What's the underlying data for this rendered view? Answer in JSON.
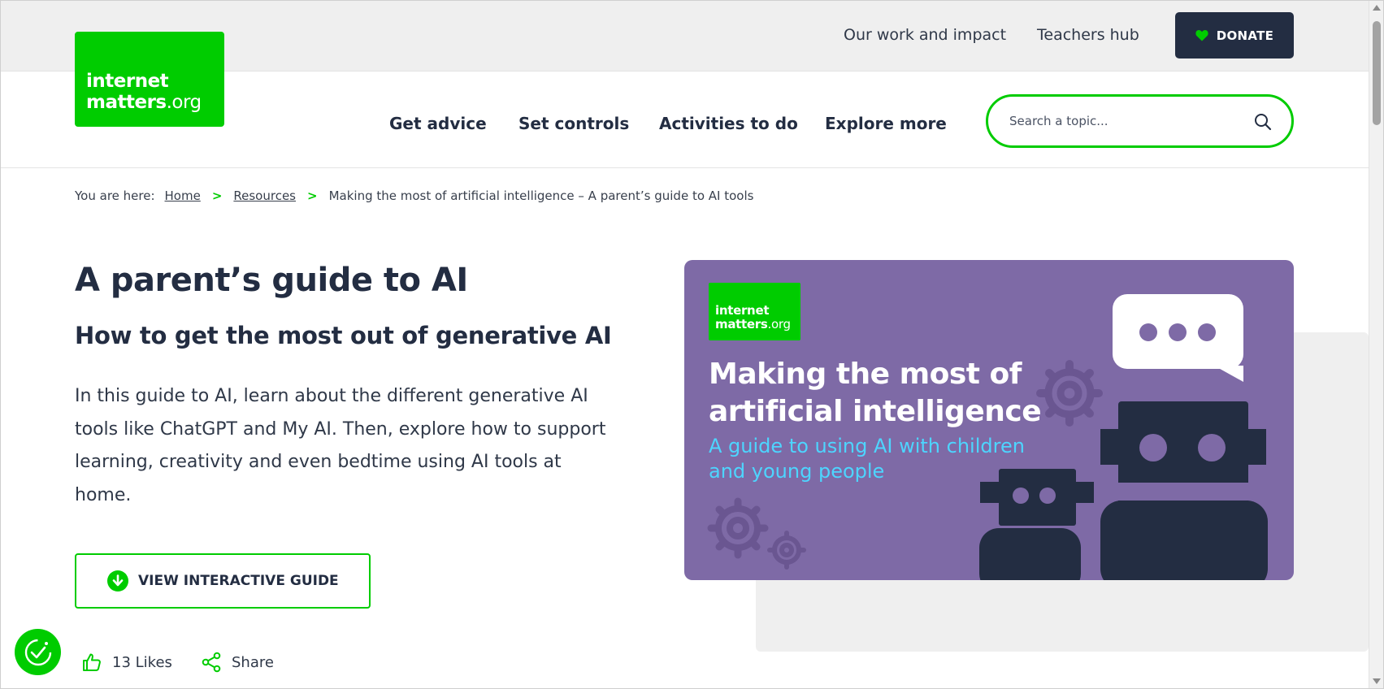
{
  "header": {
    "logo": {
      "line1": "internet",
      "line2": "matters",
      "line2_suffix": ".org"
    },
    "top_links": [
      "Our work and impact",
      "Teachers hub"
    ],
    "donate_label": "DONATE",
    "nav": [
      "Get advice",
      "Set controls",
      "Activities to do",
      "Explore more"
    ],
    "search": {
      "placeholder": "Search a topic...",
      "value": ""
    }
  },
  "breadcrumb": {
    "lead": "You are here:",
    "items": [
      "Home",
      "Resources",
      "Making the most of artificial intelligence – A parent’s guide to AI tools"
    ]
  },
  "article": {
    "title": "A parent’s guide to AI",
    "subtitle": "How to get the most out of generative AI",
    "description": "In this guide to AI, learn about the different generative AI tools like ChatGPT and My AI. Then, explore how to support learning, creativity and even bedtime using AI tools at home.",
    "guide_button": "VIEW INTERACTIVE GUIDE",
    "likes": "13 Likes",
    "share": "Share"
  },
  "hero": {
    "logo": {
      "line1": "internet",
      "line2": "matters",
      "line2_suffix": ".org"
    },
    "title": "Making the most of artificial intelligence",
    "subtitle": "A guide to using AI with children and young people"
  },
  "colors": {
    "brand_green": "#00cc00",
    "navy": "#232d42",
    "hero_purple": "#7e6aa6",
    "hero_subtitle_blue": "#4dd5ff",
    "topbar_grey": "#efefef"
  },
  "icons": [
    "heart-icon",
    "search-icon",
    "chevron-right-icon",
    "download-arrow-icon",
    "thumbs-up-icon",
    "share-icon",
    "accessibility-icon"
  ]
}
